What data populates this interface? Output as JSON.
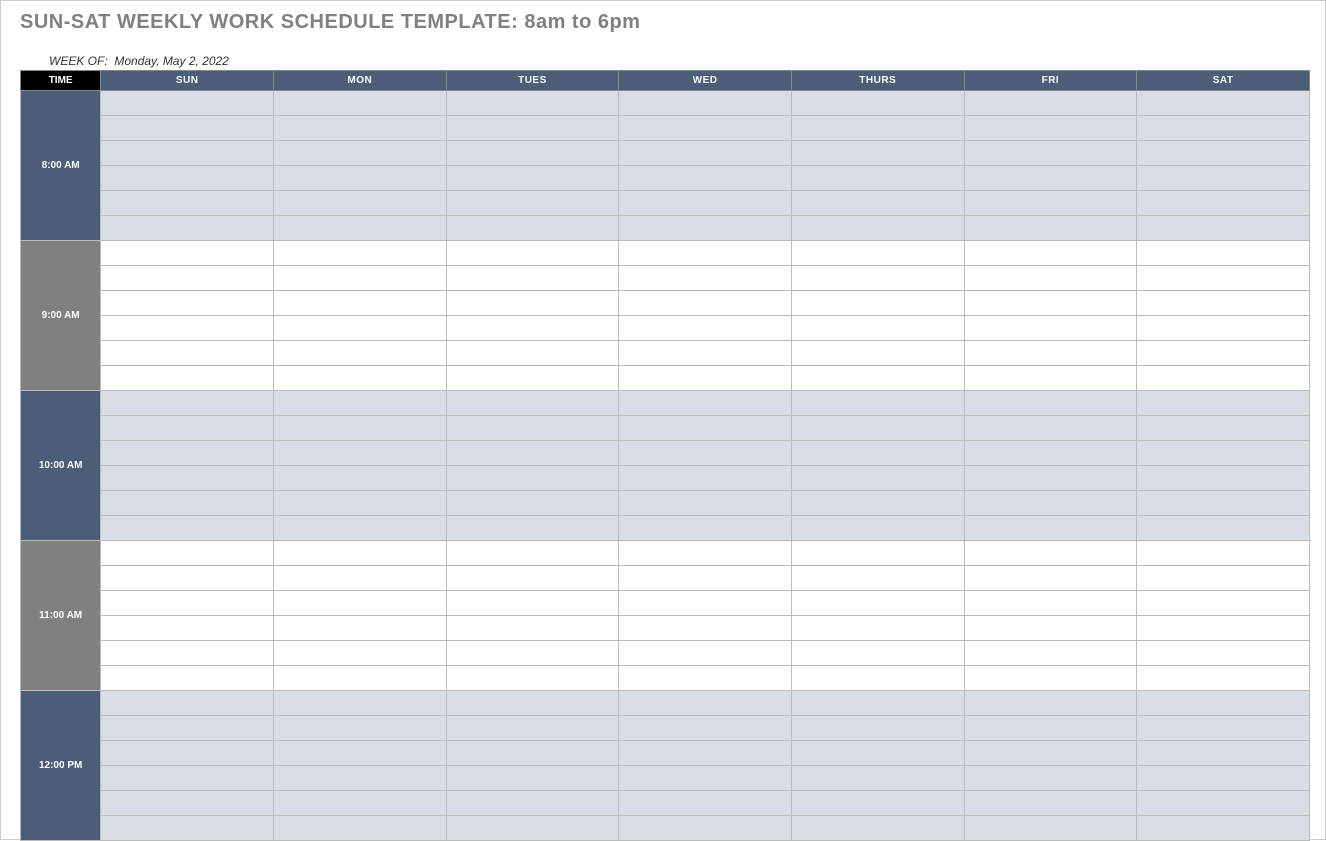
{
  "title": "SUN-SAT WEEKLY WORK SCHEDULE TEMPLATE: 8am to 6pm",
  "week_of_label": "WEEK OF:",
  "week_of_value": "Monday, May 2, 2022",
  "headers": {
    "time": "TIME",
    "days": [
      "SUN",
      "MON",
      "TUES",
      "WED",
      "THURS",
      "FRI",
      "SAT"
    ]
  },
  "time_slots": [
    {
      "label": "8:00 AM",
      "style": "dark-blue",
      "cell_style": "shaded",
      "subrows": 6
    },
    {
      "label": "9:00 AM",
      "style": "gray",
      "cell_style": "white",
      "subrows": 6
    },
    {
      "label": "10:00 AM",
      "style": "dark-blue",
      "cell_style": "shaded",
      "subrows": 6
    },
    {
      "label": "11:00 AM",
      "style": "gray",
      "cell_style": "white",
      "subrows": 6
    },
    {
      "label": "12:00 PM",
      "style": "dark-blue",
      "cell_style": "shaded",
      "subrows": 6
    }
  ]
}
